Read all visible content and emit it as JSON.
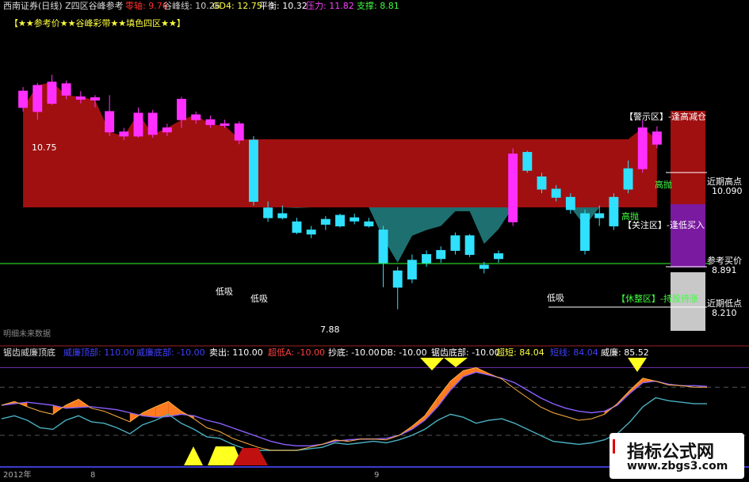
{
  "header": {
    "title": "西南证券(日线) Z四区谷峰参考",
    "items": [
      {
        "label": "零轴: 9.76",
        "color": "#ff3030"
      },
      {
        "label": "谷峰线: 10.26",
        "color": "#cfcfcf"
      },
      {
        "label": "GD4: 12.75",
        "color": "#ffff40"
      },
      {
        "label": "平衡: 10.32",
        "color": "#ffffff"
      },
      {
        "label": "压力: 11.82",
        "color": "#ff40ff"
      },
      {
        "label": "支撑: 8.81",
        "color": "#40ff40"
      }
    ],
    "subtitle": "【★★参考价★★谷峰彩带★★填色四区★★】"
  },
  "main_labels": {
    "high": "10.75",
    "low": "7.88",
    "future": "明细未来数据",
    "di_xi": [
      "低吸",
      "低吸",
      "低吸"
    ],
    "gao_pao": [
      "高抛",
      "高抛"
    ]
  },
  "zones": [
    {
      "label": "【警示区】-逢高减仓",
      "color": "#ffffff"
    },
    {
      "label": "近期高点",
      "value": "10.090",
      "color": "#ffffff"
    },
    {
      "label": "【关注区】-逢低买入",
      "color": "#ffffff"
    },
    {
      "label": "参考买价",
      "value": "8.891",
      "color": "#ffffff"
    },
    {
      "label": "【休整区】-持股待涨",
      "color": "#40ff40"
    },
    {
      "label": "近期低点",
      "value": "8.210",
      "color": "#ffffff"
    }
  ],
  "indicator": {
    "name": "锯齿威廉顶底",
    "items": [
      {
        "label": "威廉顶部: 110.00",
        "color": "#4040ff"
      },
      {
        "label": "威廉底部: -10.00",
        "color": "#4040ff"
      },
      {
        "label": "卖出: 110.00",
        "color": "#ffffff"
      },
      {
        "label": "超低A: -10.00",
        "color": "#ff4040"
      },
      {
        "label": "抄底: -10.00",
        "color": "#ffffff"
      },
      {
        "label": "DB: -10.00",
        "color": "#ffffff"
      },
      {
        "label": "锯齿底部: -10.00",
        "color": "#ffffff"
      },
      {
        "label": "超短: 84.04",
        "color": "#ffff40"
      },
      {
        "label": "短线: 84.04",
        "color": "#4040ff"
      },
      {
        "label": "威廉: 85.52",
        "color": "#ffffff"
      }
    ]
  },
  "date_labels": [
    "2012年",
    "8",
    "9"
  ],
  "watermark": {
    "line1": "指标公式网",
    "line2": "www.zbgs3.com"
  },
  "chart_data": {
    "type": "candlestick",
    "price_ylim": [
      7.5,
      11.2
    ],
    "reference_line": 9.76,
    "candles": [
      {
        "o": 10.55,
        "c": 10.35,
        "h": 10.6,
        "l": 10.3
      },
      {
        "o": 10.3,
        "c": 10.62,
        "h": 10.65,
        "l": 10.2
      },
      {
        "o": 10.4,
        "c": 10.66,
        "h": 10.75,
        "l": 10.38
      },
      {
        "o": 10.64,
        "c": 10.5,
        "h": 10.68,
        "l": 10.45
      },
      {
        "o": 10.45,
        "c": 10.48,
        "h": 10.55,
        "l": 10.4
      },
      {
        "o": 10.47,
        "c": 10.44,
        "h": 10.5,
        "l": 10.35
      },
      {
        "o": 10.3,
        "c": 10.05,
        "h": 10.5,
        "l": 10.0
      },
      {
        "o": 10.05,
        "c": 10.0,
        "h": 10.1,
        "l": 9.95
      },
      {
        "o": 10.0,
        "c": 10.28,
        "h": 10.35,
        "l": 9.98
      },
      {
        "o": 10.28,
        "c": 10.02,
        "h": 10.32,
        "l": 9.98
      },
      {
        "o": 10.05,
        "c": 10.1,
        "h": 10.15,
        "l": 10.0
      },
      {
        "o": 10.45,
        "c": 10.2,
        "h": 10.48,
        "l": 10.1
      },
      {
        "o": 10.2,
        "c": 10.26,
        "h": 10.3,
        "l": 10.15
      },
      {
        "o": 10.2,
        "c": 10.14,
        "h": 10.25,
        "l": 10.1
      },
      {
        "o": 10.15,
        "c": 10.13,
        "h": 10.2,
        "l": 10.1
      },
      {
        "o": 10.15,
        "c": 9.95,
        "h": 10.18,
        "l": 9.9
      },
      {
        "o": 9.95,
        "c": 9.2,
        "h": 10.0,
        "l": 9.15
      },
      {
        "o": 9.0,
        "c": 9.12,
        "h": 9.2,
        "l": 8.95
      },
      {
        "o": 9.0,
        "c": 9.05,
        "h": 9.15,
        "l": 8.98
      },
      {
        "o": 8.95,
        "c": 8.82,
        "h": 9.0,
        "l": 8.8
      },
      {
        "o": 8.8,
        "c": 8.85,
        "h": 8.9,
        "l": 8.75
      },
      {
        "o": 8.92,
        "c": 8.98,
        "h": 9.02,
        "l": 8.85
      },
      {
        "o": 8.9,
        "c": 9.03,
        "h": 9.05,
        "l": 8.88
      },
      {
        "o": 9.0,
        "c": 8.96,
        "h": 9.05,
        "l": 8.92
      },
      {
        "o": 8.95,
        "c": 8.9,
        "h": 9.0,
        "l": 8.88
      },
      {
        "o": 8.85,
        "c": 8.45,
        "h": 8.9,
        "l": 8.15
      },
      {
        "o": 8.35,
        "c": 8.15,
        "h": 8.4,
        "l": 7.88
      },
      {
        "o": 8.25,
        "c": 8.48,
        "h": 8.55,
        "l": 8.2
      },
      {
        "o": 8.45,
        "c": 8.55,
        "h": 8.6,
        "l": 8.4
      },
      {
        "o": 8.5,
        "c": 8.6,
        "h": 8.65,
        "l": 8.45
      },
      {
        "o": 8.6,
        "c": 8.78,
        "h": 8.82,
        "l": 8.55
      },
      {
        "o": 8.55,
        "c": 8.78,
        "h": 8.8,
        "l": 8.52
      },
      {
        "o": 8.42,
        "c": 8.38,
        "h": 8.46,
        "l": 8.32
      },
      {
        "o": 8.5,
        "c": 8.56,
        "h": 8.6,
        "l": 8.45
      },
      {
        "o": 8.95,
        "c": 9.78,
        "h": 9.85,
        "l": 8.9
      },
      {
        "o": 9.8,
        "c": 9.58,
        "h": 9.82,
        "l": 9.55
      },
      {
        "o": 9.5,
        "c": 9.35,
        "h": 9.55,
        "l": 9.3
      },
      {
        "o": 9.35,
        "c": 9.25,
        "h": 9.4,
        "l": 9.2
      },
      {
        "o": 9.25,
        "c": 9.1,
        "h": 9.3,
        "l": 9.05
      },
      {
        "o": 9.05,
        "c": 8.6,
        "h": 9.1,
        "l": 8.55
      },
      {
        "o": 9.0,
        "c": 9.05,
        "h": 9.15,
        "l": 8.9
      },
      {
        "o": 8.9,
        "c": 9.25,
        "h": 9.3,
        "l": 8.85
      },
      {
        "o": 9.35,
        "c": 9.6,
        "h": 9.7,
        "l": 9.3
      },
      {
        "o": 9.6,
        "c": 10.1,
        "h": 10.2,
        "l": 9.55
      },
      {
        "o": 10.05,
        "c": 9.9,
        "h": 10.12,
        "l": 9.85
      }
    ],
    "indicator_ylim": [
      -20,
      120
    ],
    "indicator_series": [
      {
        "values": [
          60,
          65,
          58,
          52,
          48,
          60,
          68,
          56,
          52,
          45,
          38,
          50,
          58,
          65,
          52,
          42,
          30,
          25,
          16,
          10,
          4,
          0,
          0,
          0,
          4,
          8,
          14,
          12,
          15,
          15,
          14,
          20,
          32,
          46,
          70,
          92,
          106,
          110,
          102,
          95,
          82,
          70,
          58,
          50,
          45,
          40,
          42,
          48,
          62,
          80,
          96,
          92,
          87,
          86,
          84,
          84
        ]
      },
      {
        "values": [
          60,
          62,
          64,
          62,
          60,
          56,
          57,
          58,
          56,
          54,
          50,
          46,
          44,
          45,
          48,
          46,
          40,
          36,
          30,
          24,
          18,
          12,
          8,
          6,
          6,
          8,
          12,
          14,
          15,
          15,
          16,
          20,
          28,
          40,
          58,
          80,
          98,
          104,
          100,
          96,
          90,
          80,
          70,
          62,
          56,
          52,
          50,
          52,
          60,
          76,
          90,
          92,
          88,
          86,
          86,
          85
        ]
      },
      {
        "values": [
          42,
          46,
          40,
          30,
          28,
          40,
          46,
          38,
          36,
          30,
          22,
          34,
          40,
          48,
          36,
          28,
          18,
          16,
          8,
          2,
          0,
          0,
          0,
          0,
          2,
          4,
          10,
          8,
          10,
          12,
          10,
          14,
          20,
          28,
          40,
          48,
          44,
          36,
          40,
          42,
          36,
          28,
          20,
          12,
          10,
          8,
          10,
          14,
          22,
          38,
          58,
          70,
          66,
          64,
          62,
          62
        ]
      }
    ],
    "overbought": 84,
    "oversold": 20
  }
}
